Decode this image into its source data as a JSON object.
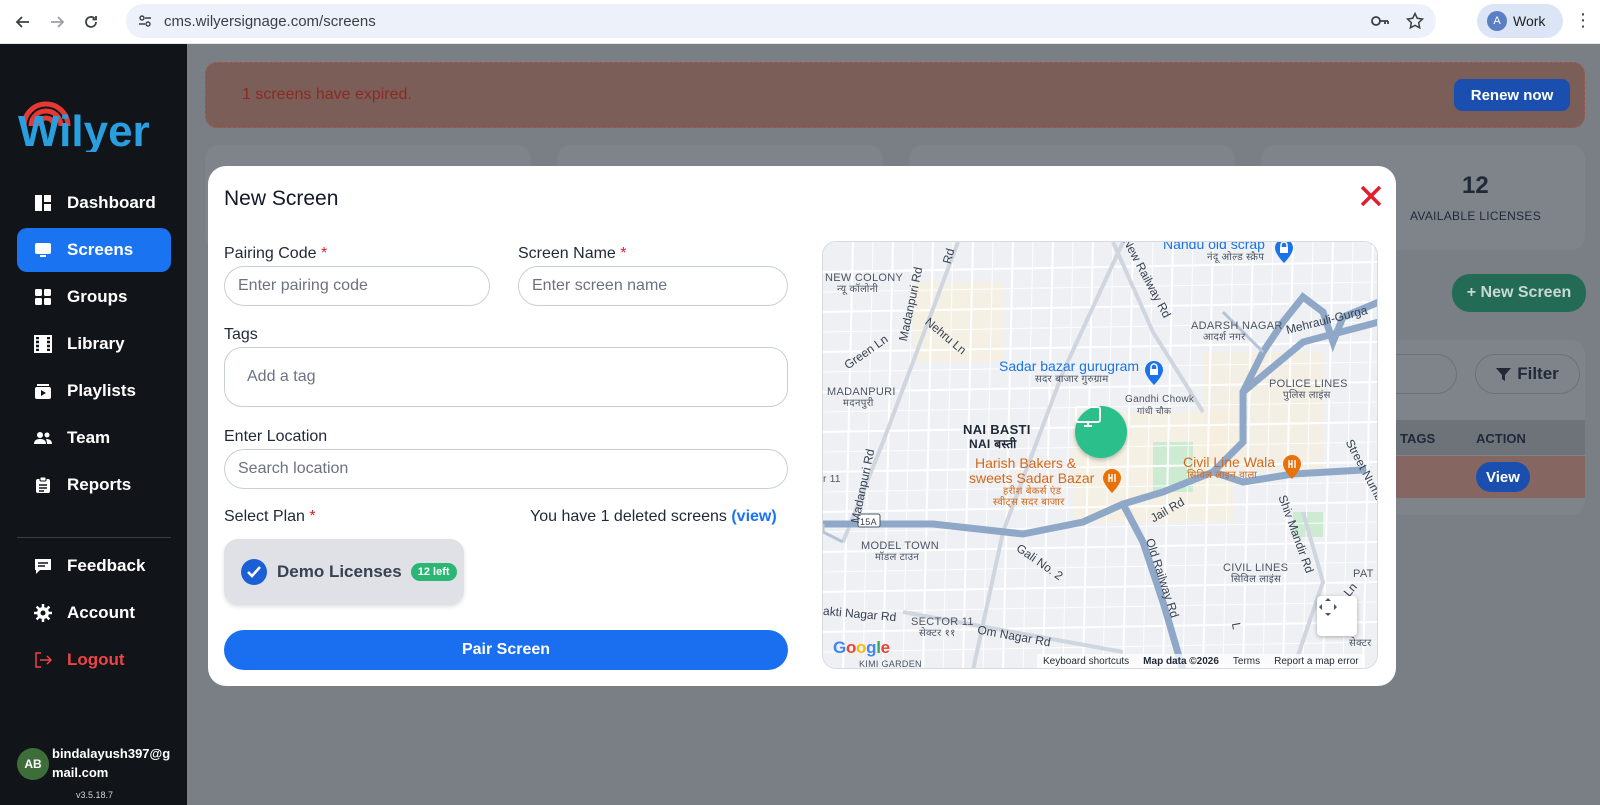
{
  "browser": {
    "url": "cms.wilyersignage.com/screens",
    "profile_initial": "A",
    "profile_label": "Work"
  },
  "sidebar": {
    "logo_text": "Wilyer",
    "items": [
      {
        "label": "Dashboard",
        "icon": "dashboard-icon"
      },
      {
        "label": "Screens",
        "icon": "monitor-icon",
        "active": true
      },
      {
        "label": "Groups",
        "icon": "grid-icon"
      },
      {
        "label": "Library",
        "icon": "film-icon"
      },
      {
        "label": "Playlists",
        "icon": "playlist-icon"
      },
      {
        "label": "Team",
        "icon": "team-icon"
      },
      {
        "label": "Reports",
        "icon": "clipboard-icon"
      }
    ],
    "bottom_items": [
      {
        "label": "Feedback",
        "icon": "feedback-icon"
      },
      {
        "label": "Account",
        "icon": "gear-icon"
      },
      {
        "label": "Logout",
        "icon": "logout-icon"
      }
    ],
    "user": {
      "initials": "AB",
      "email": "bindalayush397@gmail.com"
    },
    "version": "v3.5.18.7"
  },
  "background_page": {
    "banner_text": "1 screens have expired.",
    "renew_label": "Renew now",
    "available_licenses_count": "12",
    "available_licenses_label": "AVAILABLE LICENSES",
    "new_screen_label": "+ New Screen",
    "filter_label": "Filter",
    "table_headers": [
      "TAGS",
      "ACTION"
    ],
    "view_label": "View"
  },
  "modal": {
    "title": "New Screen",
    "pairing_code": {
      "label": "Pairing Code",
      "placeholder": "Enter pairing code",
      "value": ""
    },
    "screen_name": {
      "label": "Screen Name",
      "placeholder": "Enter screen name",
      "value": ""
    },
    "tags": {
      "label": "Tags",
      "placeholder": "Add a tag"
    },
    "location": {
      "label": "Enter Location",
      "placeholder": "Search location"
    },
    "select_plan_label": "Select Plan",
    "required_mark": "*",
    "deleted_note": "You have 1 deleted screens",
    "deleted_link": "(view)",
    "plan": {
      "name": "Demo Licenses",
      "badge": "12 left",
      "selected": true
    },
    "pair_button": "Pair Screen"
  },
  "map": {
    "labels": {
      "nandu": "Nandu old scrap",
      "nandu_hi": "नंदू ओल्ड स्क्रैप",
      "new_colony": "NEW COLONY",
      "new_colony_hi": "न्यू कॉलोनी",
      "new_railway_rd": "New Railway Rd",
      "madanpuri_rd_top": "Madanpuri Rd",
      "rd_top": "Rd",
      "nehru_ln": "Nehru Ln",
      "green_ln": "Green Ln",
      "adarsh_nagar": "ADARSH NAGAR",
      "adarsh_nagar_hi": "आदर्श नगर",
      "mehrauli": "Mehrauli-Gurga",
      "sadar_bazar": "Sadar bazar gurugram",
      "sadar_bazar_hi": "सदर बाजार गुरुग्राम",
      "madanpuri": "MADANPURI",
      "madanpuri_hi": "मदनपुरी",
      "gandhi_chowk": "Gandhi Chowk",
      "gandhi_chowk_hi": "गांधी चौक",
      "police_lines": "POLICE LINES",
      "police_lines_hi": "पुलिस लाइंस",
      "nai_basti": "NAI BASTI",
      "nai_basti_hi": "NAI बस्ती",
      "madanpuri_rd": "Madanpuri Rd",
      "harish_bakers": "Harish Bakers &",
      "harish_bakers2": "sweets Sadar Bazar",
      "harish_bakers_hi": "हरीश बेकर्स एंड",
      "harish_bakers_hi2": "स्वीट्स सदर बाजार",
      "civil_line_wala": "Civil Line Wala",
      "civil_line_wala_hi": "सिविल लाइन वाला",
      "street_num": "Street Numb",
      "jail_rd": "Jail Rd",
      "model_town": "MODEL TOWN",
      "model_town_hi": "मॉडल टाउन",
      "gali_no2": "Gali No. 2",
      "old_railway_rd": "Old Railway Rd",
      "civil_lines": "CIVIL LINES",
      "civil_lines_hi": "सिविल लाइंस",
      "shiv_mandir": "Shiv Mandir Rd",
      "road_15a": "15A",
      "sector_11": "SECTOR 11",
      "sector_11_hi": "सेक्टर ११",
      "akti_nagar": "akti Nagar Rd",
      "om_nagar": "Om Nagar Rd",
      "forest_ln": "Forest Ln",
      "pat": "PAT",
      "sector_right": "सेक्टर",
      "r11": "r 11",
      "l_label": "L",
      "kimi_garden": "KIMI GARDEN"
    },
    "footer": {
      "shortcuts": "Keyboard shortcuts",
      "map_data": "Map data ©2026",
      "terms": "Terms",
      "report": "Report a map error"
    },
    "google_logo": "Google"
  }
}
